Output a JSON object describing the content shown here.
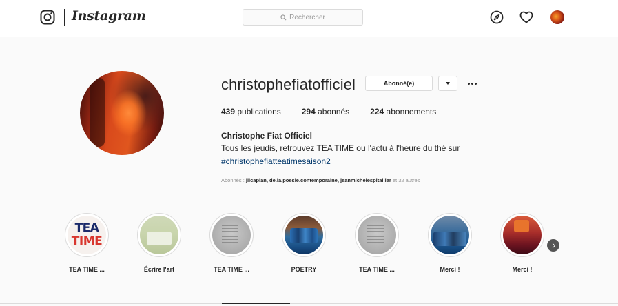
{
  "nav": {
    "brand": "Instagram",
    "search_placeholder": "Rechercher",
    "icons": [
      "instagram-glyph-icon",
      "search-icon",
      "explore-compass-icon",
      "heart-icon"
    ],
    "accent_color": "#262626"
  },
  "profile": {
    "username": "christophefiatofficiel",
    "follow_button_label": "Abonné(e)",
    "stats": {
      "posts_count": "439",
      "posts_label": "publications",
      "followers_count": "294",
      "followers_label": "abonnés",
      "following_count": "224",
      "following_label": "abonnements"
    },
    "bio_name": "Christophe Fiat Officiel",
    "bio_line": "Tous les jeudis, retrouvez TEA TIME ou l'actu à l'heure du thé sur",
    "bio_hashtag": "#christophefiatteatimesaison2",
    "followed_by": {
      "prefix": "Abonnés : ",
      "users": "jilcaplan, de.la.poesie.contemporaine, jeanmichelespitallier",
      "suffix": " et 32 autres"
    },
    "link_color": "#00376b"
  },
  "highlights": [
    {
      "label": "TEA TIME ...",
      "thumb_text_1": "TEA",
      "thumb_text_2": "TIME"
    },
    {
      "label": "Écrire l'art"
    },
    {
      "label": "TEA TIME ..."
    },
    {
      "label": "POETRY"
    },
    {
      "label": "TEA TIME ..."
    },
    {
      "label": "Merci !"
    },
    {
      "label": "Merci !"
    }
  ]
}
